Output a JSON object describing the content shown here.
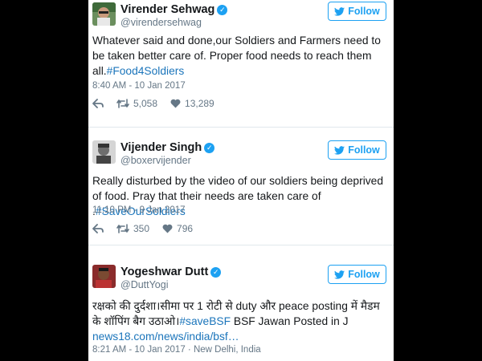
{
  "colors": {
    "accent": "#1da1f2",
    "link": "#1b75bb",
    "muted": "#657786"
  },
  "follow_label": "Follow",
  "tweets": [
    {
      "name": "Virender Sehwag",
      "handle": "@virendersehwag",
      "text": "Whatever said and done,our Soldiers and Farmers need to be taken better care of. Proper food needs to reach them all.",
      "hashtag": "#Food4Soldiers",
      "time": "8:40 AM - 10 Jan 2017",
      "retweets": "5,058",
      "likes": "13,289"
    },
    {
      "name": "Vijender Singh",
      "handle": "@boxervijender",
      "text": "Really disturbed by the video of our soldiers being deprived of food. Pray that their needs are taken care of .",
      "hashtag": "#SaveOurSoldiers",
      "time": "11:10 PM - 9 Jan 2017",
      "retweets": "350",
      "likes": "796"
    },
    {
      "name": "Yogeshwar Dutt",
      "handle": "@DuttYogi",
      "text_part1": "रक्षको की दुर्दशा।सीमा पर 1 रोटी से duty और peace posting में मैडम के शॉपिंग बैग उठाओ।",
      "hashtag": "#saveBSF",
      "text_part2": " BSF Jawan Posted in J",
      "url": "news18.com/news/india/bsf…",
      "time": "8:21 AM - 10 Jan 2017",
      "location": " · New Delhi, India"
    }
  ]
}
